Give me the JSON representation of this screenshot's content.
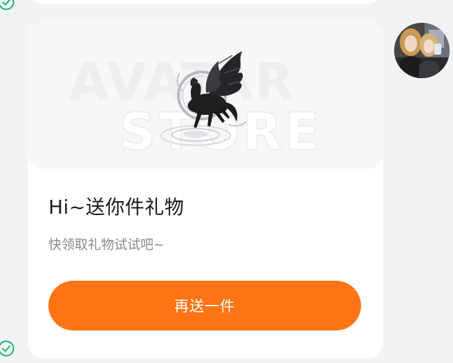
{
  "gift_card": {
    "banner_watermark": [
      "AVATAR",
      "STORE"
    ],
    "title": "Hi~送你件礼物",
    "subtitle": "快领取礼物试试吧~",
    "button_label": "再送一件"
  },
  "colors": {
    "accent": "#ff7414",
    "check": "#1bb36b",
    "background": "#f2f3f5",
    "card": "#ffffff"
  },
  "icons": {
    "status": "check-circle-icon",
    "gift": "pegasus-icon"
  }
}
